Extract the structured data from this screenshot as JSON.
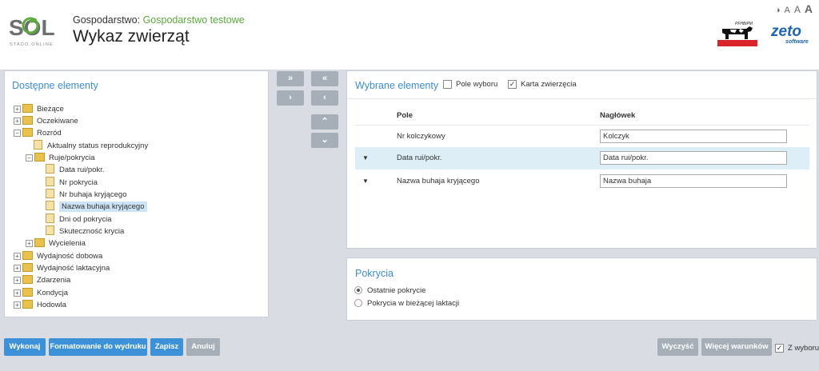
{
  "header": {
    "logo_text": "SOL",
    "logo_subtext": "STADO.ONLINE",
    "farm_label": "Gospodarstwo:",
    "farm_name": "Gospodarstwo testowe",
    "page_title": "Wykaz zwierząt",
    "contrast_icon": "contrast-icon",
    "font_sizes": [
      "A",
      "A",
      "A"
    ],
    "partner_logo_text": "PFHBiPM",
    "zeto_logo": "zeto",
    "zeto_sub": "software"
  },
  "available": {
    "title": "Dostępne elementy",
    "tree": [
      {
        "label": "Bieżące",
        "expander": "+",
        "type": "folder"
      },
      {
        "label": "Oczekiwane",
        "expander": "+",
        "type": "folder"
      },
      {
        "label": "Rozród",
        "expander": "−",
        "type": "folder"
      },
      {
        "label": "Aktualny status reprodukcyjny",
        "expander": "",
        "type": "leaf"
      },
      {
        "label": "Ruje/pokrycia",
        "expander": "−",
        "type": "folder"
      },
      {
        "label": "Data rui/pokr.",
        "expander": "",
        "type": "leaf"
      },
      {
        "label": "Nr pokrycia",
        "expander": "",
        "type": "leaf"
      },
      {
        "label": "Nr buhaja kryjącego",
        "expander": "",
        "type": "leaf"
      },
      {
        "label": "Nazwa buhaja kryjącego",
        "expander": "",
        "type": "leaf",
        "selected": true
      },
      {
        "label": "Dni od pokrycia",
        "expander": "",
        "type": "leaf"
      },
      {
        "label": "Skuteczność krycia",
        "expander": "",
        "type": "leaf"
      },
      {
        "label": "Wycielenia",
        "expander": "+",
        "type": "folder"
      },
      {
        "label": "Wydajność dobowa",
        "expander": "+",
        "type": "folder"
      },
      {
        "label": "Wydajność laktacyjna",
        "expander": "+",
        "type": "folder"
      },
      {
        "label": "Zdarzenia",
        "expander": "+",
        "type": "folder"
      },
      {
        "label": "Kondycja",
        "expander": "+",
        "type": "folder"
      },
      {
        "label": "Hodowla",
        "expander": "+",
        "type": "folder"
      }
    ]
  },
  "controls": {
    "add_all": "»",
    "remove_all": "«",
    "add_one": "›",
    "remove_one": "‹",
    "move_up": "⌃",
    "move_down": "⌄"
  },
  "selected": {
    "title": "Wybrane elementy",
    "pole_wyboru_label": "Pole wyboru",
    "pole_wyboru_checked": false,
    "karta_label": "Karta zwierzęcia",
    "karta_checked": true,
    "col_pole": "Pole",
    "col_naglowek": "Nagłówek",
    "rows": [
      {
        "field": "Nr kolczykowy",
        "header": "Kolczyk",
        "arrow": ""
      },
      {
        "field": "Data rui/pokr.",
        "header": "Data rui/pokr.",
        "arrow": "▼"
      },
      {
        "field": "Nazwa buhaja kryjącego",
        "header": "Nazwa buhaja",
        "arrow": "▼"
      }
    ]
  },
  "pokrycia": {
    "title": "Pokrycia",
    "options": [
      {
        "label": "Ostatnie pokrycie",
        "checked": true
      },
      {
        "label": "Pokrycia w bieżącej laktacji",
        "checked": false
      }
    ]
  },
  "actions": {
    "wykonaj": "Wykonaj",
    "formatowanie": "Formatowanie do wydruku",
    "zapisz": "Zapisz",
    "anuluj": "Anuluj",
    "wyczysc": "Wyczyść",
    "wiecej": "Więcej warunków",
    "z_wyboru": "Z wyboru",
    "z_wyboru_checked": true
  },
  "colors": {
    "accent_blue": "#3d91d9",
    "brand_green": "#5aaa3c",
    "button_gray": "#a6aeb7",
    "row_highlight": "#ddeef7"
  }
}
